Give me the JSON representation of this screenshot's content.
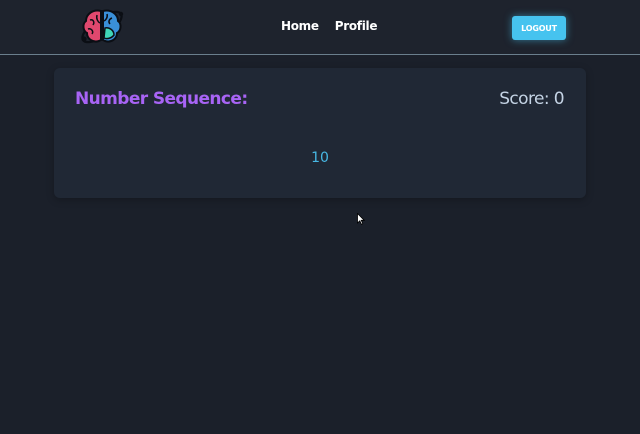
{
  "nav": {
    "links": [
      {
        "label": "Home"
      },
      {
        "label": "Profile"
      }
    ],
    "logout_label": "LOGOUT",
    "logo_icon": "brain-icon"
  },
  "game": {
    "title": "Number Sequence:",
    "score_label": "Score: ",
    "score_value": "0",
    "current_number": "10"
  },
  "colors": {
    "background": "#1b202a",
    "navbar": "#1e232d",
    "card": "#202835",
    "accent_purple": "#a864f5",
    "accent_cyan": "#46c3ef",
    "number_blue": "#47b8e4",
    "score_text": "#c4d3e4"
  }
}
